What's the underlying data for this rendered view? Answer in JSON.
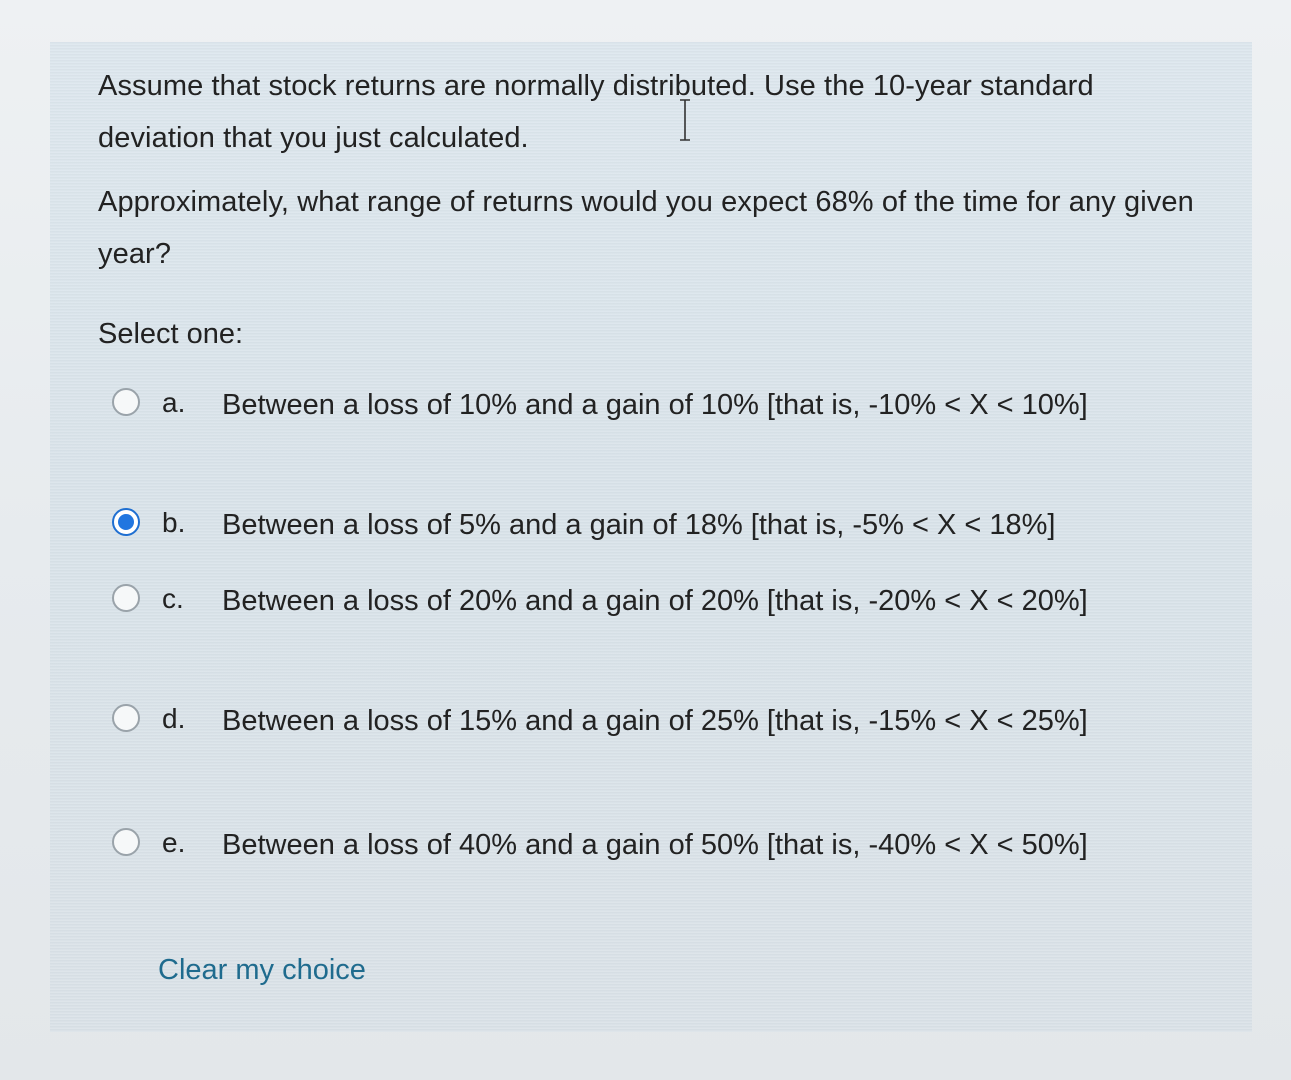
{
  "question": {
    "line1": "Assume that stock returns are normally distributed. Use the 10-year standard deviation that you just calculated.",
    "line2": "Approximately, what range of returns would you expect 68% of the time for any given year?"
  },
  "select_prompt": "Select one:",
  "options": [
    {
      "letter": "a.",
      "text": "Between a loss of 10% and a gain of 10% [that is, -10% < X < 10%]",
      "selected": false
    },
    {
      "letter": "b.",
      "text": "Between a loss of 5% and a gain of 18% [that is, -5% < X < 18%]",
      "selected": true
    },
    {
      "letter": "c.",
      "text": "Between a loss of 20% and a gain of 20% [that is, -20% < X < 20%]",
      "selected": false
    },
    {
      "letter": "d.",
      "text": "Between a loss of 15% and a gain of 25% [that is, -15% < X < 25%]",
      "selected": false
    },
    {
      "letter": "e.",
      "text": "Between a loss of 40% and a gain of 50% [that is, -40% < X < 50%]",
      "selected": false
    }
  ],
  "clear_link": "Clear my choice",
  "colors": {
    "accent": "#2176e0",
    "link": "#1f6b8e",
    "panel_bg": "#dbe5ec"
  }
}
